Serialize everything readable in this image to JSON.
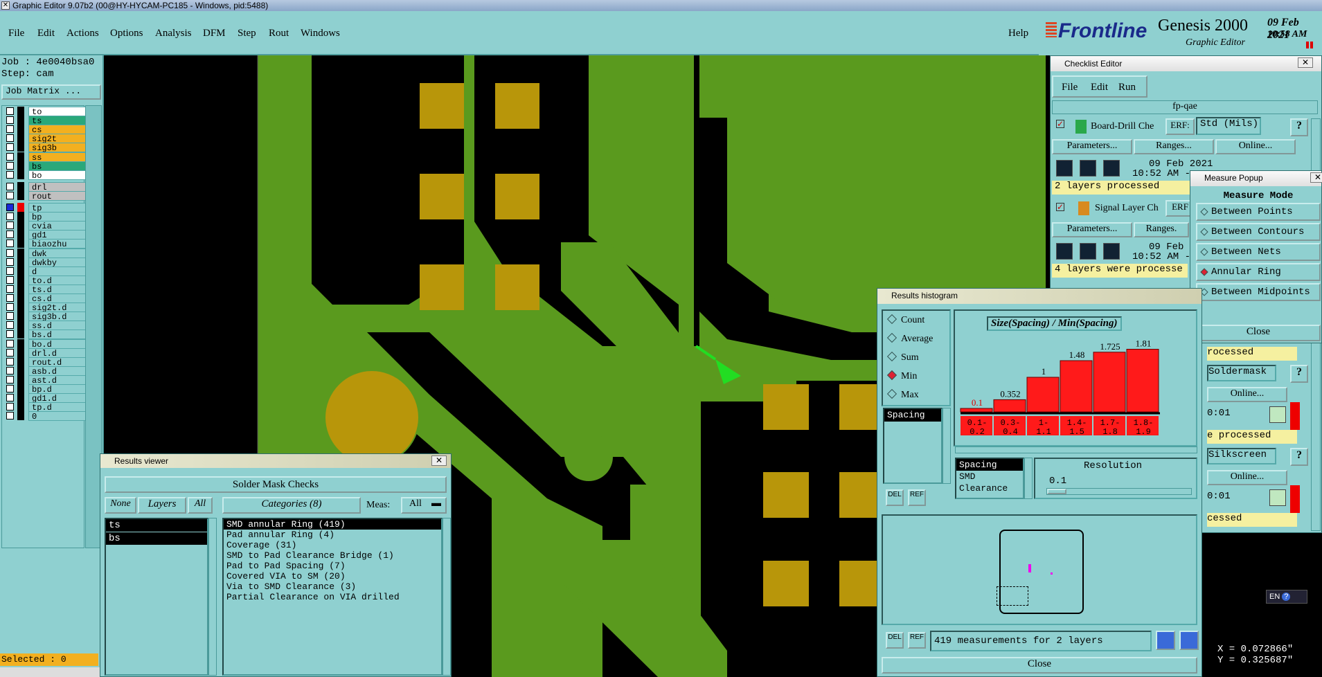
{
  "window": {
    "title": "Graphic Editor 9.07b2 (00@HY-HYCAM-PC185 - Windows, pid:5488)"
  },
  "menu": {
    "items": [
      "File",
      "Edit",
      "Actions",
      "Options",
      "Analysis",
      "DFM",
      "Step",
      "Rout",
      "Windows"
    ],
    "help": "Help"
  },
  "brand": {
    "logo": "Frontline",
    "product": "Genesis 2000",
    "sub": "Graphic Editor",
    "date": "09 Feb 2021",
    "time": "10:58 AM"
  },
  "left": {
    "job": "Job : 4e0040bsa0",
    "step": "Step: cam",
    "matrix_btn": "Job Matrix ...",
    "selected": "Selected : 0",
    "layers_a": [
      {
        "n": "to",
        "c": "#ffffff"
      },
      {
        "n": "ts",
        "c": "#2aa87a"
      },
      {
        "n": "cs",
        "c": "#f2b020"
      },
      {
        "n": "sig2t",
        "c": "#f2b020"
      },
      {
        "n": "sig3b",
        "c": "#f2b020"
      },
      {
        "n": "ss",
        "c": "#f2b020"
      },
      {
        "n": "bs",
        "c": "#2aa87a"
      },
      {
        "n": "bo",
        "c": "#ffffff"
      }
    ],
    "layers_b": [
      {
        "n": "drl",
        "c": "#c0c0c0"
      },
      {
        "n": "rout",
        "c": "#c0c0c0"
      }
    ],
    "layers_c": [
      "tp",
      "bp",
      "cvia",
      "gd1",
      "biaozhu",
      "dwk",
      "dwkby",
      "d",
      "to.d",
      "ts.d",
      "cs.d",
      "sig2t.d",
      "sig3b.d",
      "ss.d",
      "bs.d",
      "bo.d",
      "drl.d",
      "rout.d",
      "asb.d",
      "ast.d",
      "bp.d",
      "gd1.d",
      "tp.d",
      "0"
    ]
  },
  "checklist": {
    "title": "Checklist Editor",
    "menu": [
      "File",
      "Edit",
      "Run"
    ],
    "name": "fp-qae",
    "check1": {
      "name": "Board-Drill Che",
      "erf": "ERF:",
      "std": "Std (Mils)",
      "params": "Parameters...",
      "ranges": "Ranges...",
      "online": "Online...",
      "date": "09 Feb 2021",
      "time": "10:52 AM -",
      "status": "2 layers processed"
    },
    "check2": {
      "name": "Signal Layer Ch",
      "erf": "ERF",
      "params": "Parameters...",
      "ranges": "Ranges.",
      "date": "09 Feb",
      "time": "10:52 AM -",
      "status": "4 layers were processe"
    },
    "right_frag": {
      "a": "rocessed",
      "b": "Soldermask",
      "c": "Online...",
      "d": "0:01",
      "e": "e processed",
      "f": "Silkscreen",
      "g": "Online...",
      "h": "0:01",
      "i": "cessed",
      "q": "?"
    }
  },
  "measure": {
    "title": "Measure Popup",
    "header": "Measure Mode",
    "modes": [
      "Between Points",
      "Between Contours",
      "Between Nets",
      "Annular Ring",
      "Between Midpoints"
    ],
    "active": "Annular Ring",
    "close": "Close"
  },
  "histogram": {
    "title": "Results histogram",
    "radios": [
      "Count",
      "Average",
      "Sum",
      "Min",
      "Max"
    ],
    "active": "Min",
    "heading": "Size(Spacing) / Min(Spacing)",
    "list_sel": "Spacing",
    "list2": [
      "Spacing",
      "SMD",
      "Clearance"
    ],
    "resolution_label": "Resolution",
    "resolution": "0.1",
    "status": "419 measurements for 2 layers",
    "close": "Close"
  },
  "chart_data": {
    "type": "bar",
    "title": "Size(Spacing) / Min(Spacing)",
    "categories": [
      "0.1-0.2",
      "0.3-0.4",
      "1-1.1",
      "1.4-1.5",
      "1.7-1.8",
      "1.8-1.9"
    ],
    "values": [
      0.1,
      0.352,
      1,
      1.48,
      1.725,
      1.81
    ],
    "value_labels": [
      "0.1",
      "0.352",
      "1",
      "1.48",
      "1.725",
      "1.81"
    ],
    "cat_top": [
      "0.1-",
      "0.3-",
      "1-",
      "1.4-",
      "1.7-",
      "1.8-"
    ],
    "cat_bot": [
      "0.2",
      "0.4",
      "1.1",
      "1.5",
      "1.8",
      "1.9"
    ],
    "ylim": [
      0,
      2
    ]
  },
  "results": {
    "title": "Results viewer",
    "heading": "Solder Mask Checks",
    "none": "None",
    "layers": "Layers",
    "all": "All",
    "categories": "Categories (8)",
    "meas": "Meas:",
    "meas_val": "All",
    "layer_list": [
      "ts",
      "bs"
    ],
    "cat_list": [
      "SMD annular Ring (419)",
      "Pad annular Ring (4)",
      "Coverage (31)",
      "SMD to Pad Clearance Bridge (1)",
      "Pad to Pad Spacing (7)",
      "Covered VIA to SM (20)",
      "Via to SMD Clearance (3)",
      "Partial Clearance on VIA drilled"
    ]
  },
  "coords": {
    "x": "X = 0.072866\"",
    "y": "Y = 0.325687\""
  },
  "ime": {
    "lang": "EN"
  },
  "colors": {
    "panel": "#8fd0d0",
    "copper": "#5a9a1e",
    "pad": "#b8960a",
    "bar": "#ff1a1a",
    "arrow": "#22dd22"
  }
}
